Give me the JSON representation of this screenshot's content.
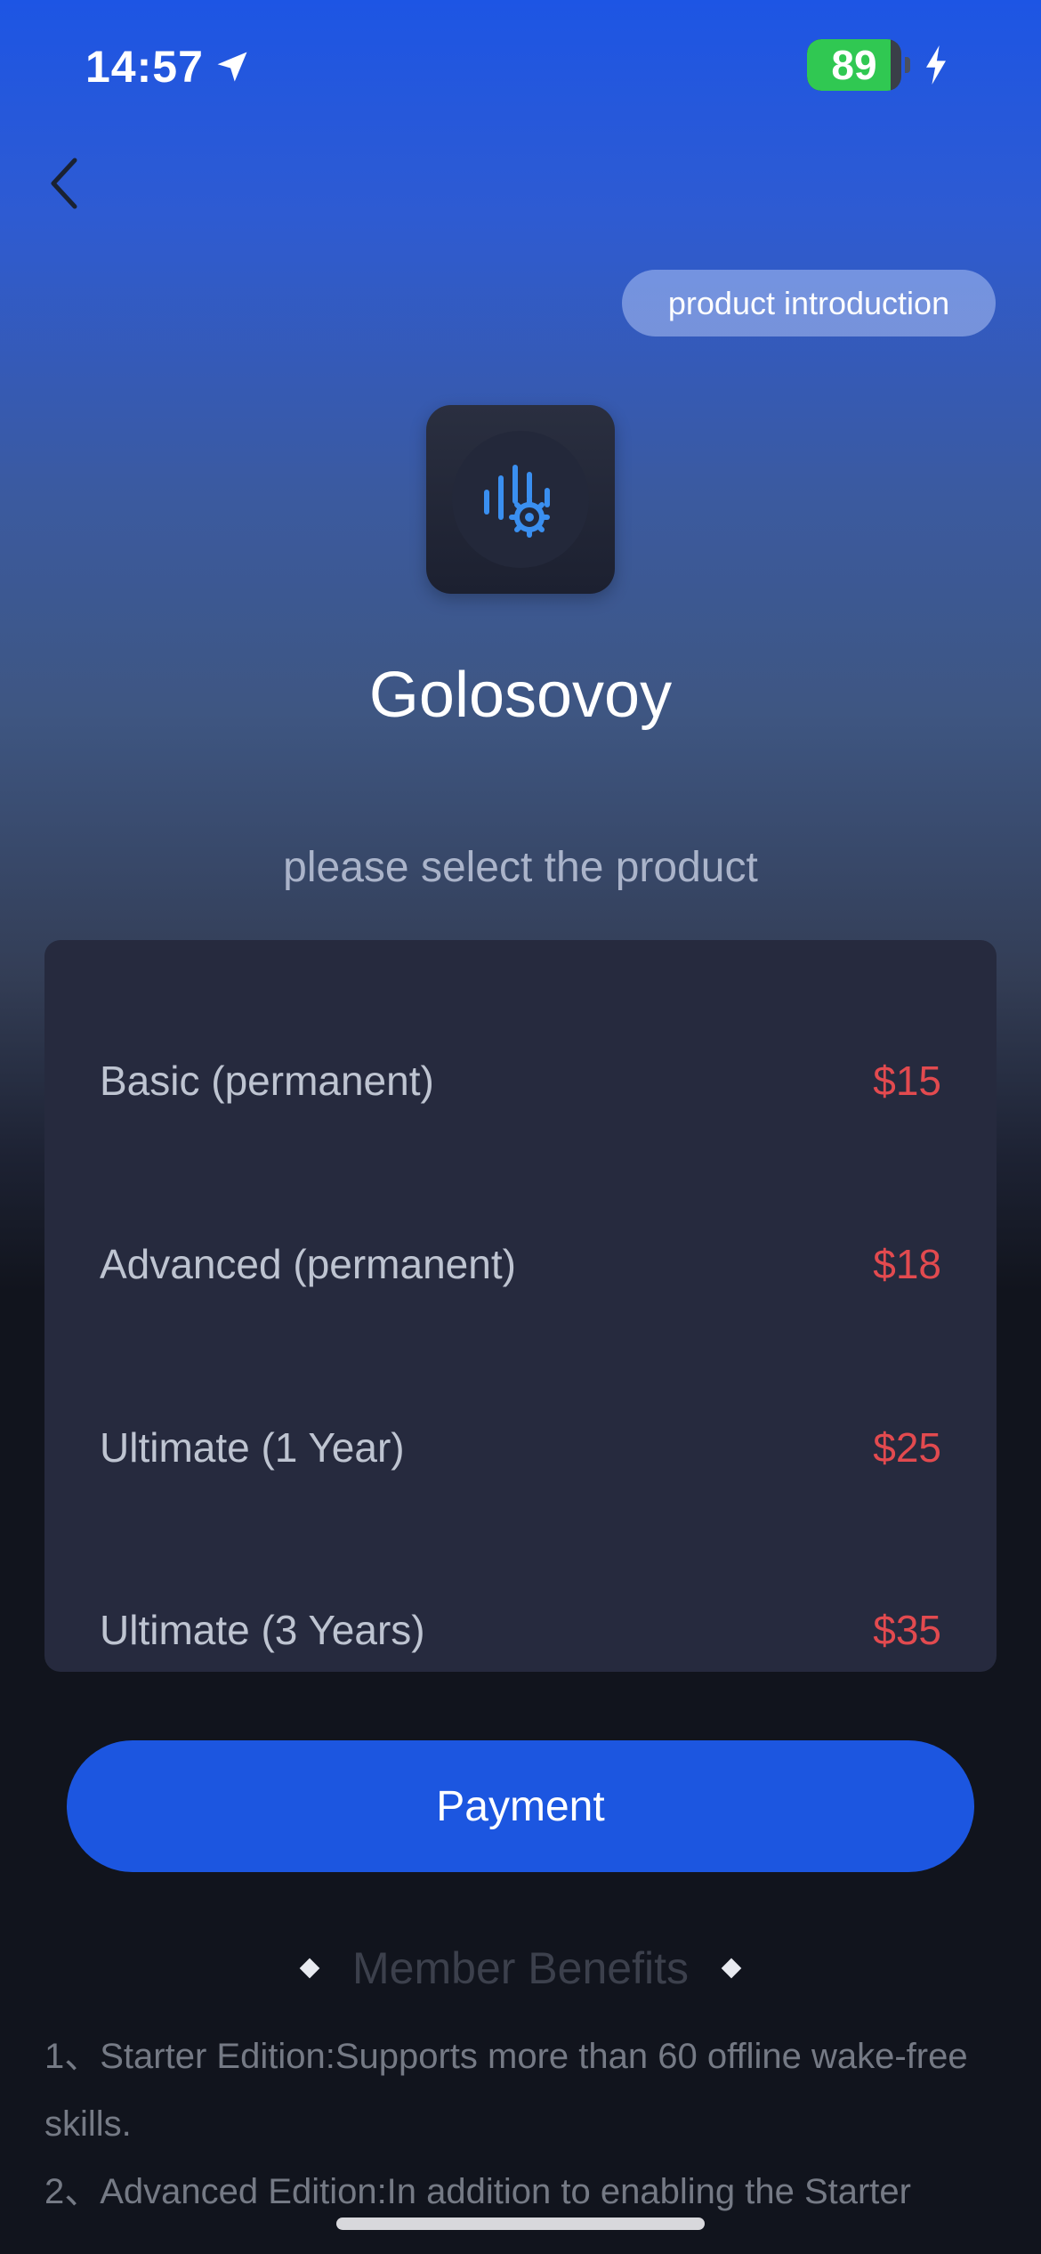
{
  "status_bar": {
    "time": "14:57",
    "battery_level": 89,
    "battery_label": "89",
    "location_icon": "location-arrow-icon",
    "charging_icon": "lightning-bolt-icon"
  },
  "nav": {
    "back_icon": "chevron-left-icon",
    "intro_label": "product introduction"
  },
  "app": {
    "icon": "voice-gear-icon",
    "name": "Golosovoy"
  },
  "select_prompt": "please select the product",
  "products": [
    {
      "name": "Basic (permanent)",
      "price": "$15"
    },
    {
      "name": "Advanced (permanent)",
      "price": "$18"
    },
    {
      "name": "Ultimate (1 Year)",
      "price": "$25"
    },
    {
      "name": "Ultimate (3 Years)",
      "price": "$35"
    }
  ],
  "payment_label": "Payment",
  "benefits": {
    "title": "Member Benefits",
    "items": [
      "1、Starter Edition:Supports more than 60 offline wake-free skills.",
      "2、Advanced Edition:In addition to enabling the Starter"
    ]
  },
  "colors": {
    "accent": "#1c56e0",
    "price": "#e24a4f",
    "battery": "#30c852"
  }
}
